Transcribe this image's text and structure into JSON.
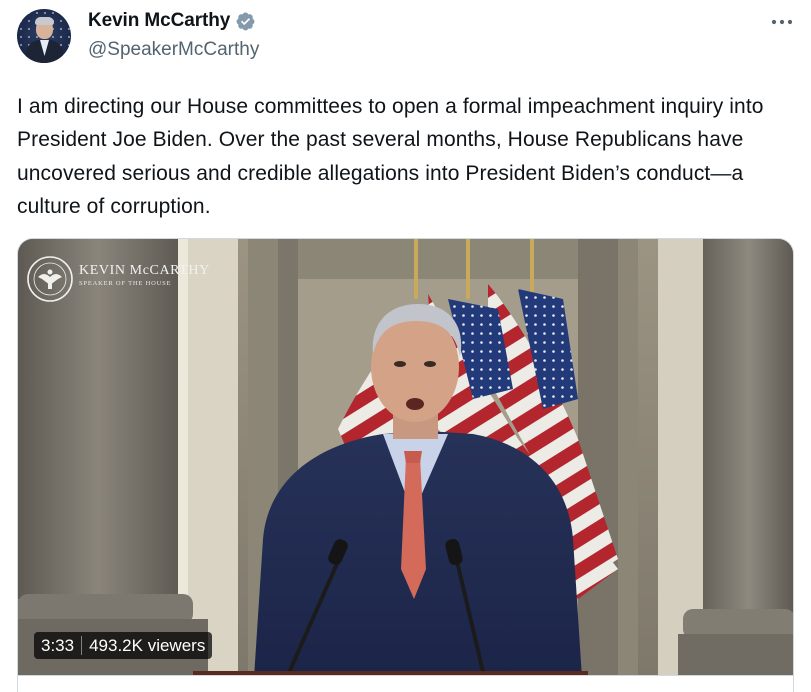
{
  "author": {
    "display_name": "Kevin McCarthy",
    "handle": "@SpeakerMcCarthy",
    "verified_icon": "verified-badge-icon",
    "verified_color": "#829aab"
  },
  "tweet": {
    "text": "I am directing our House committees to open a formal impeachment inquiry into President Joe Biden. Over the past several months, House Republicans have uncovered serious and credible allegations into President Biden’s conduct—a culture of corruption."
  },
  "menu": {
    "more_icon": "more-options-icon"
  },
  "video": {
    "watermark_name": "KEVIN McCARTHY",
    "watermark_title": "SPEAKER OF THE HOUSE",
    "duration": "3:33",
    "views": "493.2K viewers"
  },
  "colors": {
    "text_primary": "#0f1419",
    "text_secondary": "#536471",
    "border": "#cfd9de"
  }
}
